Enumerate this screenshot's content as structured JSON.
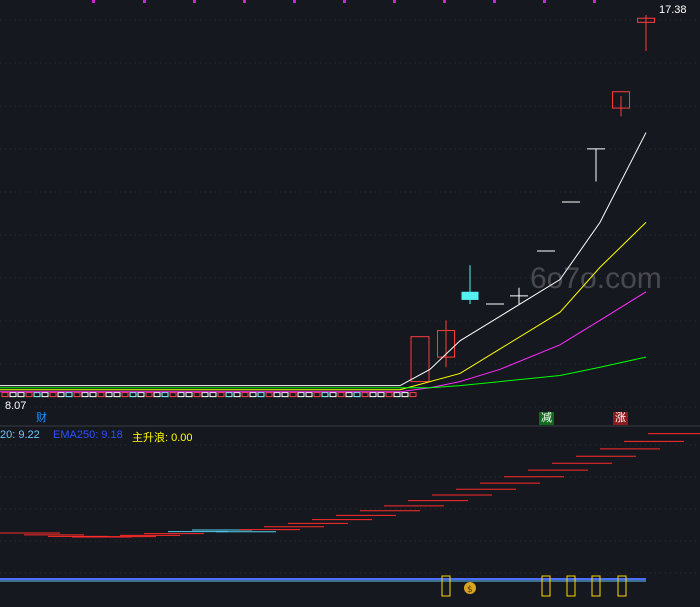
{
  "chart_data": {
    "type": "candlestick",
    "main": {
      "high_label": "17.38",
      "low_label": "8.07",
      "ylim": [
        7.9,
        17.6
      ],
      "candles": [
        {
          "o": 9.0,
          "h": 9.9,
          "l": 8.75,
          "c": 9.65,
          "dir": "up"
        },
        {
          "o": 10.6,
          "h": 11.25,
          "l": 10.3,
          "c": 10.4,
          "dir": "down"
        },
        {
          "o": 10.3,
          "h": 10.3,
          "l": 10.3,
          "c": 10.3,
          "dir": "doji"
        },
        {
          "o": 10.5,
          "h": 10.7,
          "l": 10.3,
          "c": 10.5,
          "dir": "doji"
        },
        {
          "o": 11.6,
          "h": 11.6,
          "l": 11.6,
          "c": 11.6,
          "dir": "doji"
        },
        {
          "o": 12.8,
          "h": 12.8,
          "l": 12.8,
          "c": 12.8,
          "dir": "doji"
        },
        {
          "o": 14.1,
          "h": 14.1,
          "l": 13.3,
          "c": 14.1,
          "dir": "doji"
        },
        {
          "o": 15.1,
          "h": 15.4,
          "l": 14.9,
          "c": 15.5,
          "dir": "up"
        },
        {
          "o": 17.2,
          "h": 17.38,
          "l": 16.5,
          "c": 17.3,
          "dir": "up"
        }
      ],
      "ma_lines": [
        {
          "color": "#ffffff",
          "values": [
            8.3,
            8.7,
            9.4,
            10.0,
            10.9,
            12.3,
            14.5
          ]
        },
        {
          "color": "#ffff00",
          "values": [
            8.2,
            8.4,
            8.6,
            9.2,
            10.1,
            11.2,
            12.3
          ]
        },
        {
          "color": "#ff2dff",
          "values": [
            8.15,
            8.25,
            8.4,
            8.7,
            9.3,
            9.9,
            10.6
          ]
        },
        {
          "color": "#00ff00",
          "values": [
            8.25,
            8.3,
            8.4,
            8.55,
            8.75,
            9.0
          ]
        }
      ]
    },
    "indicator": {
      "legend": [
        {
          "text": "20: 9.22",
          "color": "#67c8ff"
        },
        {
          "text": "EMA250: 9.18",
          "color": "#2b4fff"
        },
        {
          "text": "主升浪: 0.00",
          "color": "#ffff00"
        }
      ]
    },
    "markers": {
      "cai": "财",
      "jian": "减",
      "zhang": "涨",
      "moneybag_icon": "money-bag-icon"
    },
    "watermark": "6o7o.com"
  }
}
